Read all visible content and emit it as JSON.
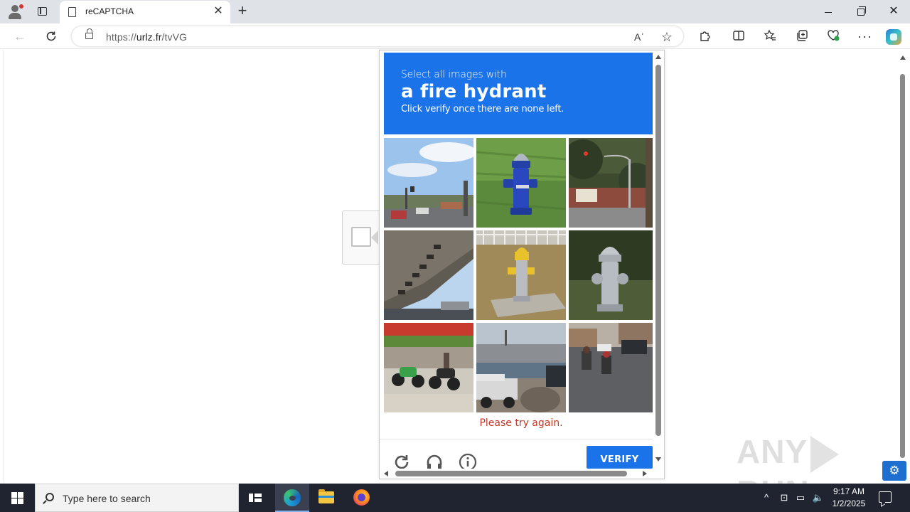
{
  "browser": {
    "tab_title": "reCAPTCHA",
    "url_prefix": "https://",
    "url_domain": "urlz.fr",
    "url_path": "/tvVG",
    "read_aloud_label": "Aʾ"
  },
  "captcha": {
    "prompt_line1": "Select all images with",
    "prompt_target": "a fire hydrant",
    "prompt_line3": "Click verify once there are none left.",
    "tiles": [
      {
        "subject": "street with cars and traffic light"
      },
      {
        "subject": "blue fire hydrant on grass"
      },
      {
        "subject": "street with traffic light"
      },
      {
        "subject": "overpass bridge underside"
      },
      {
        "subject": "yellow and silver fire hydrant"
      },
      {
        "subject": "silver fire hydrant"
      },
      {
        "subject": "parked motorcycles"
      },
      {
        "subject": "harbor with truck"
      },
      {
        "subject": "street with motorbikes"
      }
    ],
    "error_message": "Please try again.",
    "verify_label": "VERIFY",
    "colors": {
      "header": "#1a73e8",
      "error": "#c0392b"
    }
  },
  "watermark": {
    "text_left": "ANY",
    "text_right": "RUN"
  },
  "taskbar": {
    "search_placeholder": "Type here to search",
    "time": "9:17 AM",
    "date": "1/2/2025"
  }
}
